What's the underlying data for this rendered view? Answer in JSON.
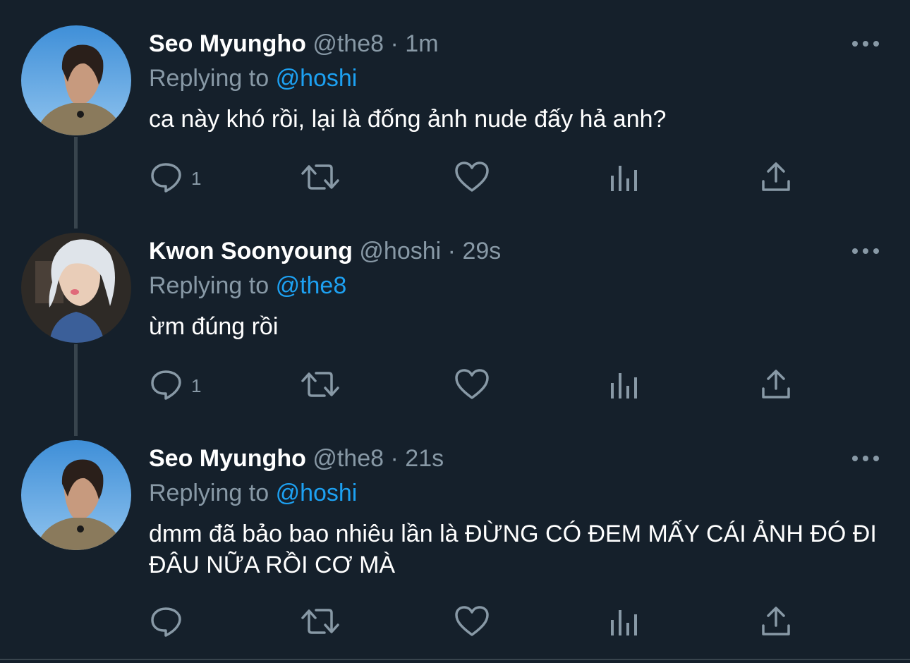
{
  "colors": {
    "background": "#15202b",
    "text": "#ffffff",
    "secondary": "#8899a6",
    "link": "#1da1f2",
    "thread_line": "#38444d"
  },
  "tweets": [
    {
      "name": "Seo Myungho",
      "handle": "@the8",
      "separator": "·",
      "time": "1m",
      "replying_prefix": "Replying to",
      "replying_to": "@hoshi",
      "text": "ca này khó rồi, lại là đống ảnh nude đấy hả anh?",
      "reply_count": "1",
      "icons": [
        "reply-icon",
        "retweet-icon",
        "like-icon",
        "analytics-icon",
        "share-icon",
        "more-icon"
      ]
    },
    {
      "name": "Kwon Soonyoung",
      "handle": "@hoshi",
      "separator": "·",
      "time": "29s",
      "replying_prefix": "Replying to",
      "replying_to": "@the8",
      "text": "ừm đúng rồi",
      "reply_count": "1",
      "icons": [
        "reply-icon",
        "retweet-icon",
        "like-icon",
        "analytics-icon",
        "share-icon",
        "more-icon"
      ]
    },
    {
      "name": "Seo Myungho",
      "handle": "@the8",
      "separator": "·",
      "time": "21s",
      "replying_prefix": "Replying to",
      "replying_to": "@hoshi",
      "text": "dmm đã bảo bao nhiêu lần là ĐỪNG CÓ ĐEM MẤY CÁI ẢNH ĐÓ ĐI ĐÂU NỮA RỒI CƠ MÀ",
      "reply_count": "",
      "icons": [
        "reply-icon",
        "retweet-icon",
        "like-icon",
        "analytics-icon",
        "share-icon",
        "more-icon"
      ]
    }
  ]
}
